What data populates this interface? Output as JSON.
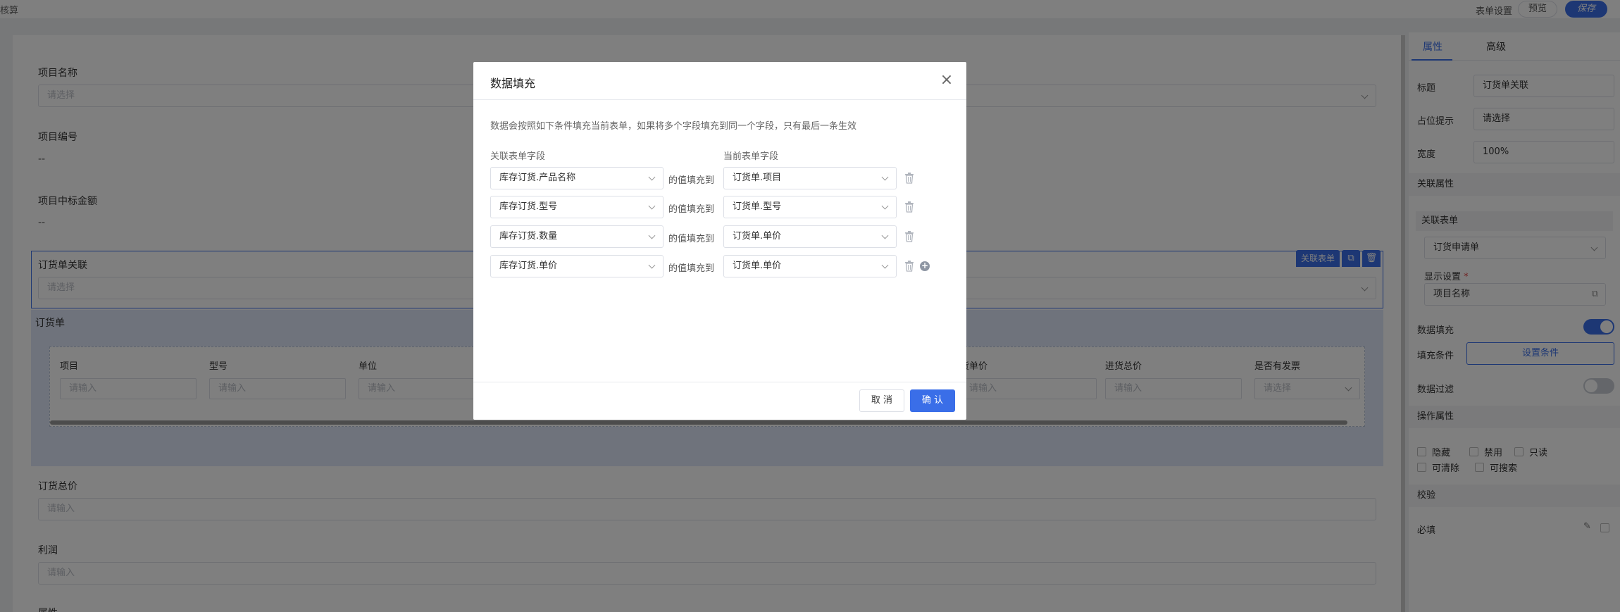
{
  "topbar": {
    "crumb": "核算",
    "form_settings": "表单设置",
    "preview": "预览",
    "save": "保存"
  },
  "canvas": {
    "project_name": {
      "label": "项目名称",
      "placeholder": "请选择"
    },
    "project_code": {
      "label": "项目编号",
      "value": "--"
    },
    "bid_amount": {
      "label": "项目中标金额",
      "value": "--"
    },
    "order_link": {
      "label": "订货单关联",
      "placeholder": "请选择",
      "tag": "关联表单"
    },
    "subform": {
      "title": "订货单",
      "columns": [
        {
          "label": "项目",
          "placeholder": "请输入"
        },
        {
          "label": "型号",
          "placeholder": "请输入"
        },
        {
          "label": "单位",
          "placeholder": "请输入"
        },
        {
          "label": "货单价",
          "placeholder": "请输入"
        },
        {
          "label": "进货总价",
          "placeholder": "请输入"
        },
        {
          "label": "是否有发票",
          "placeholder": "请选择"
        }
      ]
    },
    "order_total": {
      "label": "订货总价",
      "placeholder": "请输入"
    },
    "profit": {
      "label": "利润",
      "placeholder": "请输入"
    },
    "next_label": "属性"
  },
  "panel": {
    "tabs": [
      "属性",
      "高级"
    ],
    "title_label": "标题",
    "title_value": "订货单关联",
    "placeholder_label": "占位提示",
    "placeholder_value": "请选择",
    "width_label": "宽度",
    "width_value": "100%",
    "link_props": "关联属性",
    "link_form_label": "关联表单",
    "link_form_value": "订货申请单",
    "display_label": "显示设置",
    "display_required": "*",
    "display_value": "项目名称",
    "data_fill_label": "数据填充",
    "fill_cond_label": "填充条件",
    "fill_cond_button": "设置条件",
    "data_filter_label": "数据过滤",
    "op_props": "操作属性",
    "checkboxes": [
      "隐藏",
      "禁用",
      "只读",
      "可清除",
      "可搜索"
    ],
    "validation": "校验",
    "required_label": "必填"
  },
  "modal": {
    "title": "数据填充",
    "description": "数据会按照如下条件填充当前表单，如果将多个字段填充到同一个字段，只有最后一条生效",
    "col_source": "关联表单字段",
    "col_target": "当前表单字段",
    "fill_to": "的值填充到",
    "rows": [
      {
        "source": "库存订货.产品名称",
        "target": "订货单.项目"
      },
      {
        "source": "库存订货.型号",
        "target": "订货单.型号"
      },
      {
        "source": "库存订货.数量",
        "target": "订货单.单价"
      },
      {
        "source": "库存订货.单价",
        "target": "订货单.单价"
      }
    ],
    "cancel": "取 消",
    "confirm": "确 认"
  }
}
